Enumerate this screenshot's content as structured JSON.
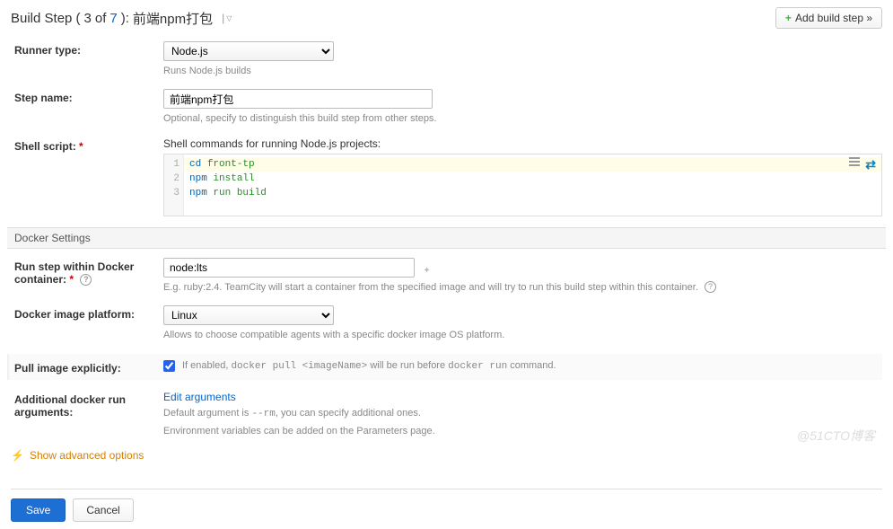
{
  "header": {
    "title_prefix": "Build Step (",
    "step_current": "3",
    "step_of": " of ",
    "step_total": "7",
    "title_suffix": "): ",
    "step_name": "前端npm打包",
    "add_button_label": "Add build step »"
  },
  "runner_type": {
    "label": "Runner type:",
    "value": "Node.js",
    "hint": "Runs Node.js builds"
  },
  "step_name_field": {
    "label": "Step name:",
    "value": "前端npm打包",
    "hint": "Optional, specify to distinguish this build step from other steps."
  },
  "shell_script": {
    "label": "Shell script:",
    "intro": "Shell commands for running Node.js projects:",
    "lines": [
      {
        "n": "1",
        "cmd": "cd",
        "arg": "front-tp",
        "hl": true
      },
      {
        "n": "2",
        "cmd": "npm",
        "arg": "install",
        "hl": false
      },
      {
        "n": "3",
        "cmd": "npm",
        "arg": "run build",
        "hl": false
      }
    ]
  },
  "docker_section": {
    "title": "Docker Settings"
  },
  "docker_container": {
    "label": "Run step within Docker container:",
    "value": "node:lts",
    "hint": "E.g. ruby:2.4. TeamCity will start a container from the specified image and will try to run this build step within this container."
  },
  "docker_platform": {
    "label": "Docker image platform:",
    "value": "Linux",
    "hint": "Allows to choose compatible agents with a specific docker image OS platform."
  },
  "pull_image": {
    "label": "Pull image explicitly:",
    "checked": true,
    "text_before": "If enabled, ",
    "code1": "docker pull <imageName>",
    "text_mid": " will be run before ",
    "code2": "docker run",
    "text_after": " command."
  },
  "docker_args": {
    "label": "Additional docker run arguments:",
    "link": "Edit arguments",
    "hint1_before": "Default argument is ",
    "hint1_code": "--rm",
    "hint1_after": ", you can specify additional ones.",
    "hint2": "Environment variables can be added on the Parameters page."
  },
  "advanced": {
    "label": "Show advanced options"
  },
  "buttons": {
    "save": "Save",
    "cancel": "Cancel"
  },
  "watermark": "@51CTO博客"
}
